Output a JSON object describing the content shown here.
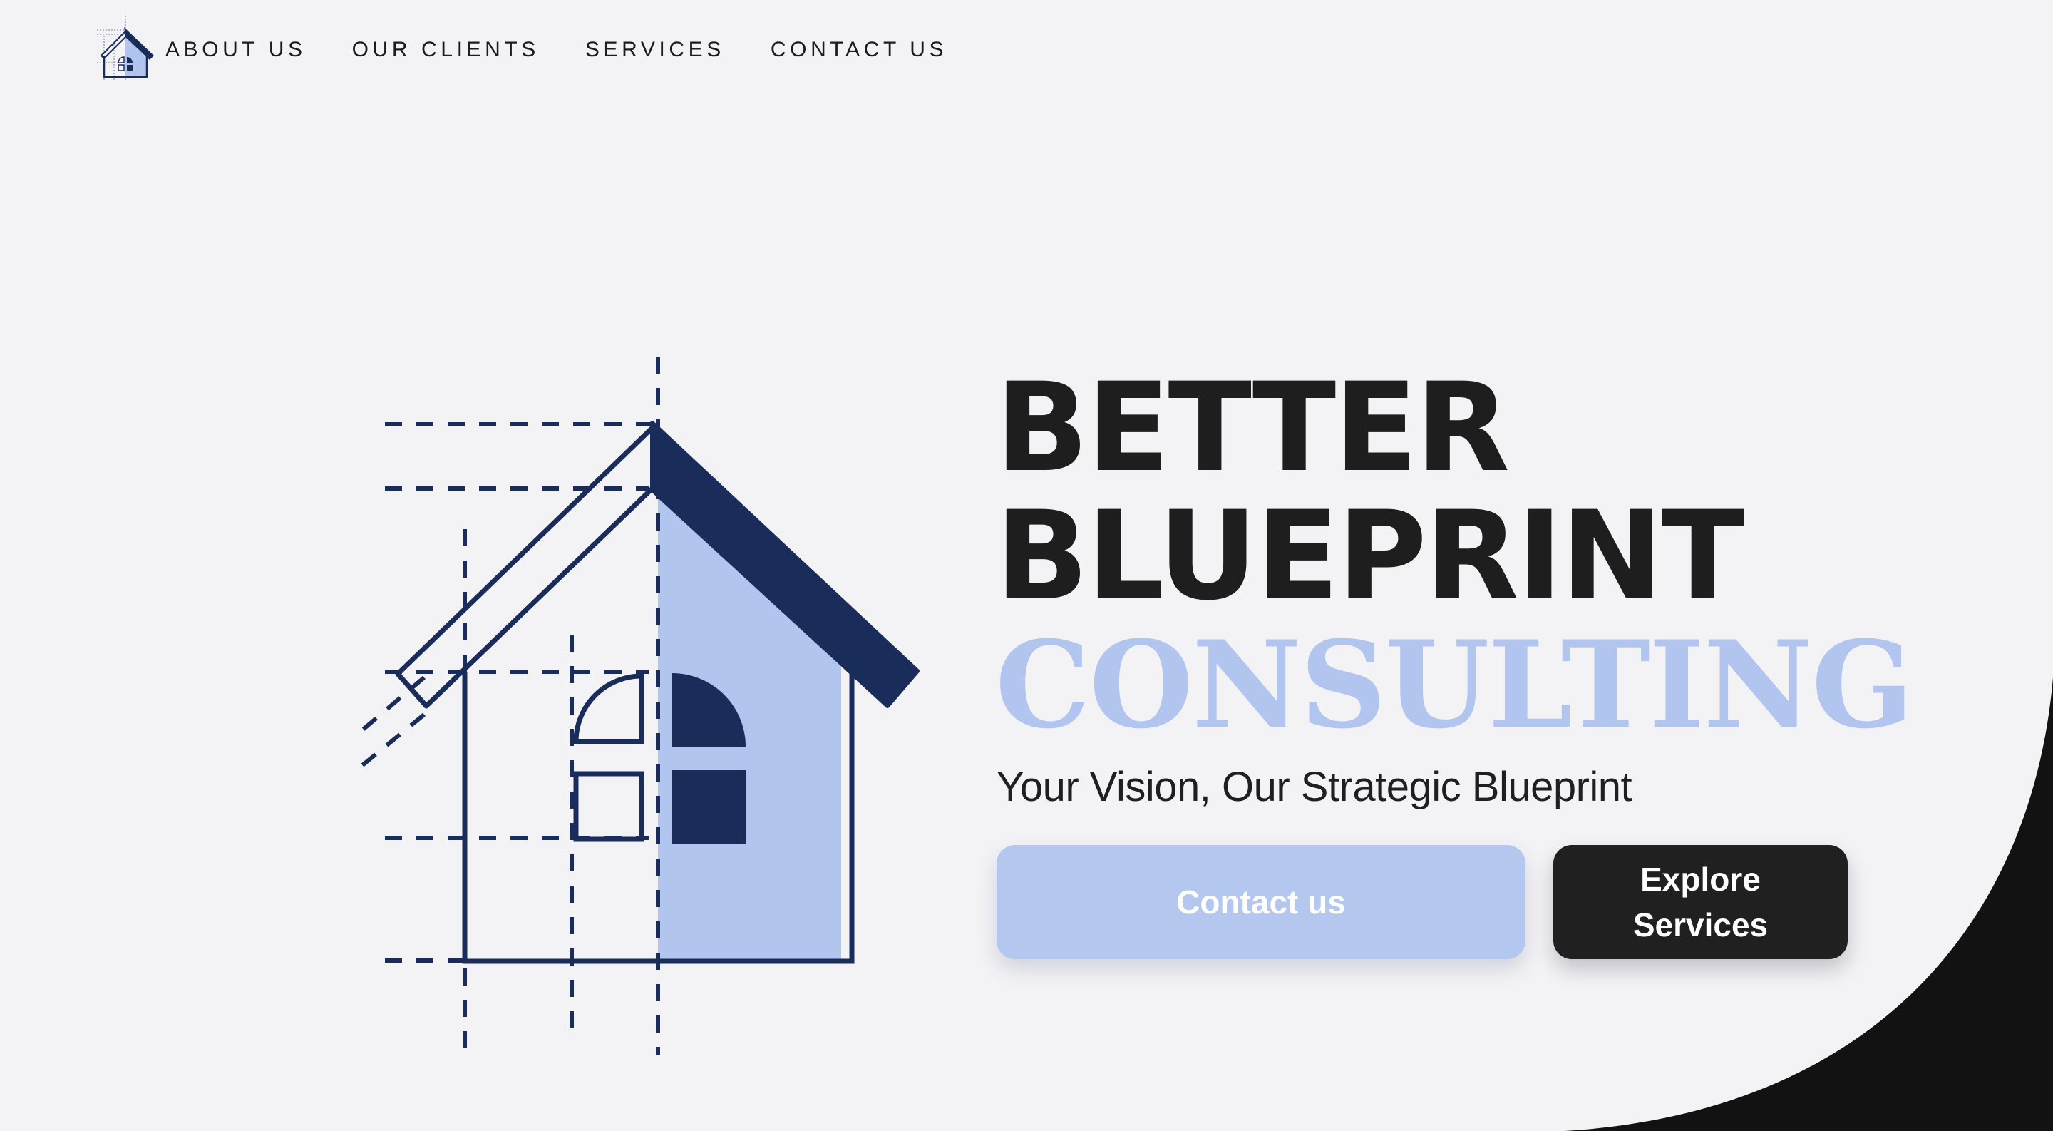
{
  "nav": {
    "logo_icon": "house-blueprint-logo-icon",
    "items": [
      {
        "label": "ABOUT US"
      },
      {
        "label": "OUR CLIENTS"
      },
      {
        "label": "SERVICES"
      },
      {
        "label": "CONTACT US"
      }
    ]
  },
  "hero": {
    "illustration_icon": "house-blueprint-icon",
    "headline": {
      "line1": "BETTER",
      "line2": "BLUEPRINT",
      "line3": "CONSULTING"
    },
    "tagline": "Your Vision, Our Strategic Blueprint",
    "buttons": {
      "contact_label": "Contact us",
      "explore_label": "Explore Services"
    }
  },
  "colors": {
    "background": "#f3f3f6",
    "navy": "#1a2d5a",
    "light_blue": "#b1c5ef",
    "text_dark": "#1e1e1e",
    "corner_black": "#121212"
  }
}
